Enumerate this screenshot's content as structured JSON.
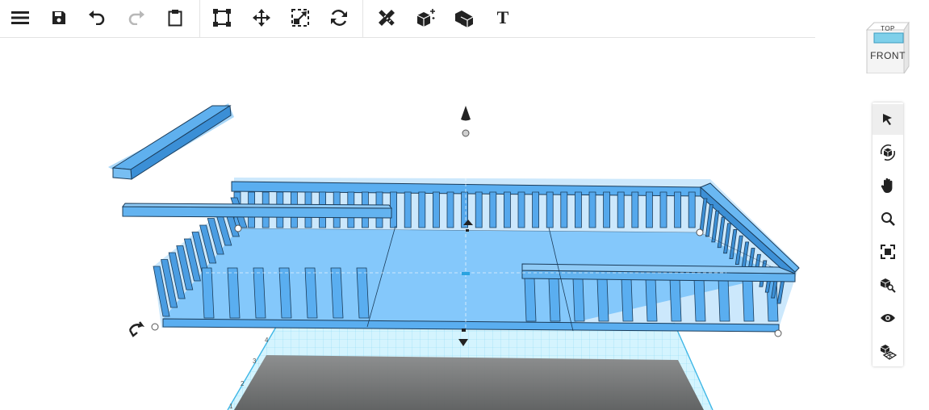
{
  "toolbar": {
    "buttons": [
      {
        "name": "menu",
        "icon": "hamburger-menu-icon"
      },
      {
        "name": "save",
        "icon": "floppy-disk-icon"
      },
      {
        "name": "undo",
        "icon": "undo-arrow-icon"
      },
      {
        "name": "redo",
        "icon": "redo-arrow-icon",
        "enabled": false
      },
      {
        "name": "clipboard",
        "icon": "clipboard-icon"
      },
      {
        "name": "bounding-box",
        "icon": "bounding-box-icon"
      },
      {
        "name": "move",
        "icon": "move-arrows-icon"
      },
      {
        "name": "scale",
        "icon": "scale-icon"
      },
      {
        "name": "rotate",
        "icon": "rotate-arrows-icon"
      },
      {
        "name": "ruler",
        "icon": "ruler-pencil-icon"
      },
      {
        "name": "add-shape",
        "icon": "cube-sparkle-icon"
      },
      {
        "name": "shapes",
        "icon": "cubes-icon"
      },
      {
        "name": "text",
        "icon": "text-icon",
        "label": "T"
      }
    ]
  },
  "viewcube": {
    "top_label": "TOP",
    "front_label": "FRONT"
  },
  "right_toolbar": {
    "buttons": [
      {
        "name": "select",
        "icon": "cursor-arrow-icon",
        "active": true
      },
      {
        "name": "orbit",
        "icon": "orbit-cube-icon"
      },
      {
        "name": "pan",
        "icon": "hand-icon"
      },
      {
        "name": "zoom",
        "icon": "magnifier-icon"
      },
      {
        "name": "fit-view",
        "icon": "fit-frame-icon"
      },
      {
        "name": "zoom-to-selected",
        "icon": "cube-magnifier-icon"
      },
      {
        "name": "visibility",
        "icon": "eye-icon"
      },
      {
        "name": "workplane",
        "icon": "workplane-icon"
      }
    ]
  },
  "workplane": {
    "ruler_ticks": [
      "4",
      "3",
      "2",
      "1"
    ]
  },
  "colors": {
    "selection_blue": "#79c3ff",
    "part_blue": "#4a9de0",
    "grid_cyan": "#bfeefd",
    "shadow_gray": "#6e6e6e"
  }
}
